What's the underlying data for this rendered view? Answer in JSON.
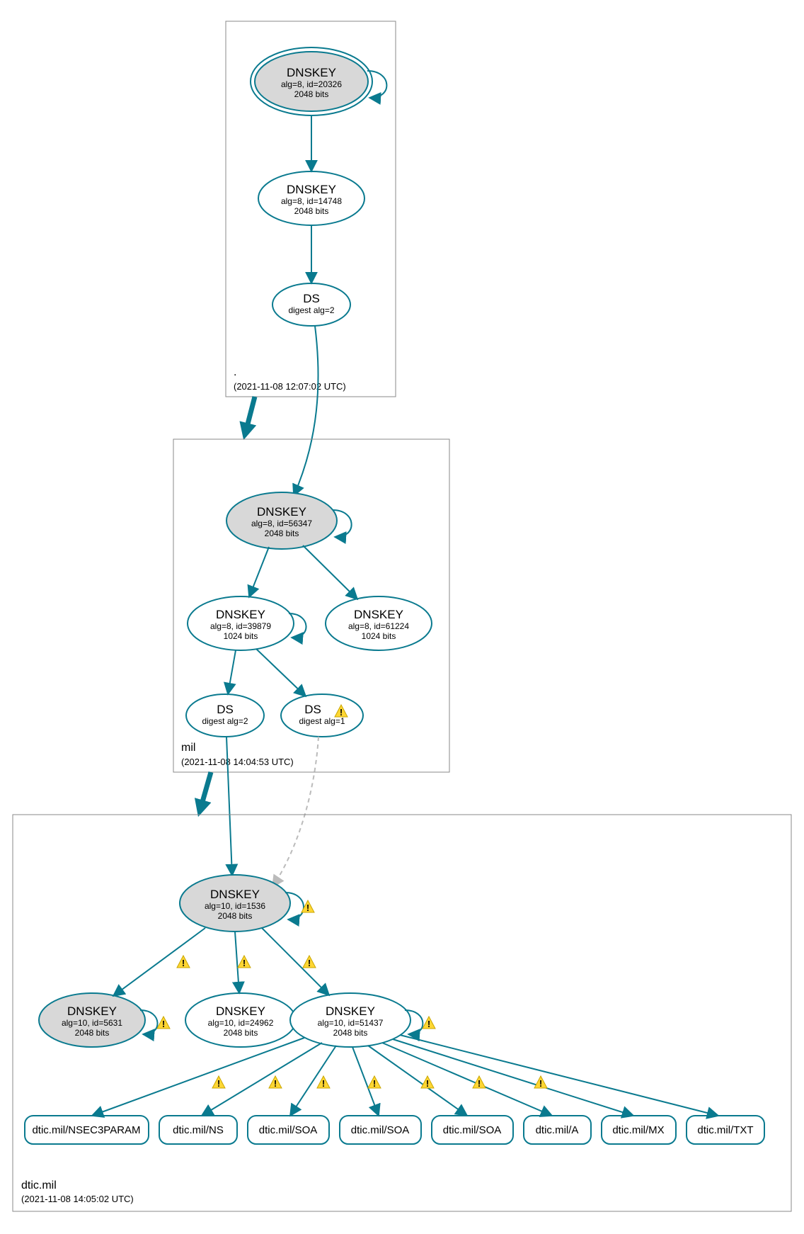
{
  "zones": {
    "root": {
      "label": ".",
      "time": "(2021-11-08 12:07:02 UTC)"
    },
    "mil": {
      "label": "mil",
      "time": "(2021-11-08 14:04:53 UTC)"
    },
    "dtic": {
      "label": "dtic.mil",
      "time": "(2021-11-08 14:05:02 UTC)"
    }
  },
  "nodes": {
    "root_ksk": {
      "title": "DNSKEY",
      "l1": "alg=8, id=20326",
      "l2": "2048 bits"
    },
    "root_zsk": {
      "title": "DNSKEY",
      "l1": "alg=8, id=14748",
      "l2": "2048 bits"
    },
    "root_ds": {
      "title": "DS",
      "l1": "digest alg=2"
    },
    "mil_ksk": {
      "title": "DNSKEY",
      "l1": "alg=8, id=56347",
      "l2": "2048 bits"
    },
    "mil_zsk1": {
      "title": "DNSKEY",
      "l1": "alg=8, id=39879",
      "l2": "1024 bits"
    },
    "mil_zsk2": {
      "title": "DNSKEY",
      "l1": "alg=8, id=61224",
      "l2": "1024 bits"
    },
    "mil_ds1": {
      "title": "DS",
      "l1": "digest alg=2"
    },
    "mil_ds2": {
      "title": "DS",
      "l1": "digest alg=1"
    },
    "dtic_ksk": {
      "title": "DNSKEY",
      "l1": "alg=10, id=1536",
      "l2": "2048 bits"
    },
    "dtic_k1": {
      "title": "DNSKEY",
      "l1": "alg=10, id=5631",
      "l2": "2048 bits"
    },
    "dtic_k2": {
      "title": "DNSKEY",
      "l1": "alg=10, id=24962",
      "l2": "2048 bits"
    },
    "dtic_k3": {
      "title": "DNSKEY",
      "l1": "alg=10, id=51437",
      "l2": "2048 bits"
    }
  },
  "rrsets": {
    "r0": "dtic.mil/NSEC3PARAM",
    "r1": "dtic.mil/NS",
    "r2": "dtic.mil/SOA",
    "r3": "dtic.mil/SOA",
    "r4": "dtic.mil/SOA",
    "r5": "dtic.mil/A",
    "r6": "dtic.mil/MX",
    "r7": "dtic.mil/TXT"
  },
  "warn": "!"
}
